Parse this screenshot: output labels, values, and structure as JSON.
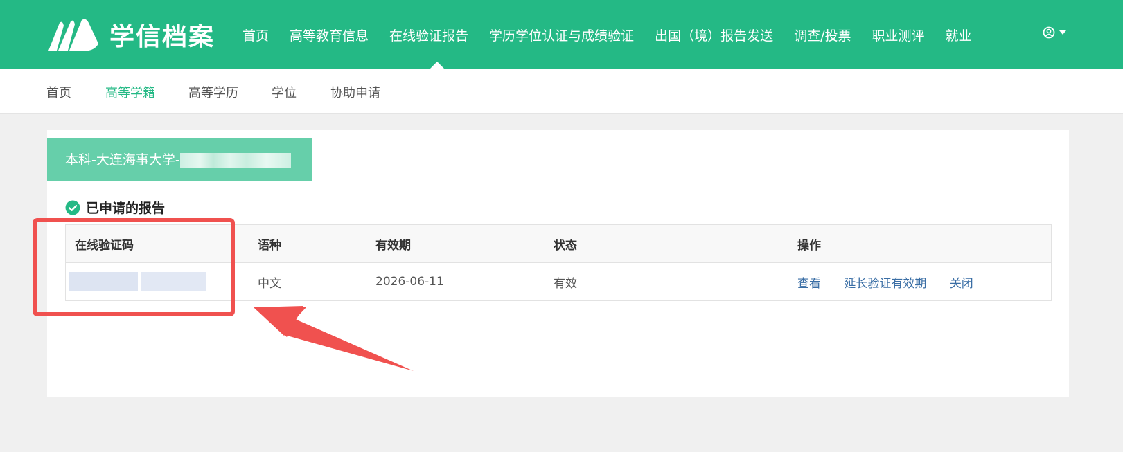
{
  "header": {
    "logo_text": "学信档案",
    "nav": [
      "首页",
      "高等教育信息",
      "在线验证报告",
      "学历学位认证与成绩验证",
      "出国（境）报告发送",
      "调查/投票",
      "职业测评",
      "就业"
    ],
    "active_nav": "在线验证报告",
    "brand_color": "#24b985",
    "user_icon": "user-circle-icon"
  },
  "subnav": {
    "items": [
      "首页",
      "高等学籍",
      "高等学历",
      "学位",
      "协助申请"
    ],
    "active": "高等学籍"
  },
  "record": {
    "tab_label": "本科-大连海事大学-"
  },
  "reports": {
    "title": "已申请的报告",
    "columns": [
      "在线验证码",
      "语种",
      "有效期",
      "状态",
      "操作"
    ],
    "rows": [
      {
        "language": "中文",
        "expiry": "2026-06-11",
        "status": "有效",
        "actions": [
          "查看",
          "延长验证有效期",
          "关闭"
        ]
      }
    ]
  },
  "annotation": {
    "highlight_color": "#f0514f"
  }
}
